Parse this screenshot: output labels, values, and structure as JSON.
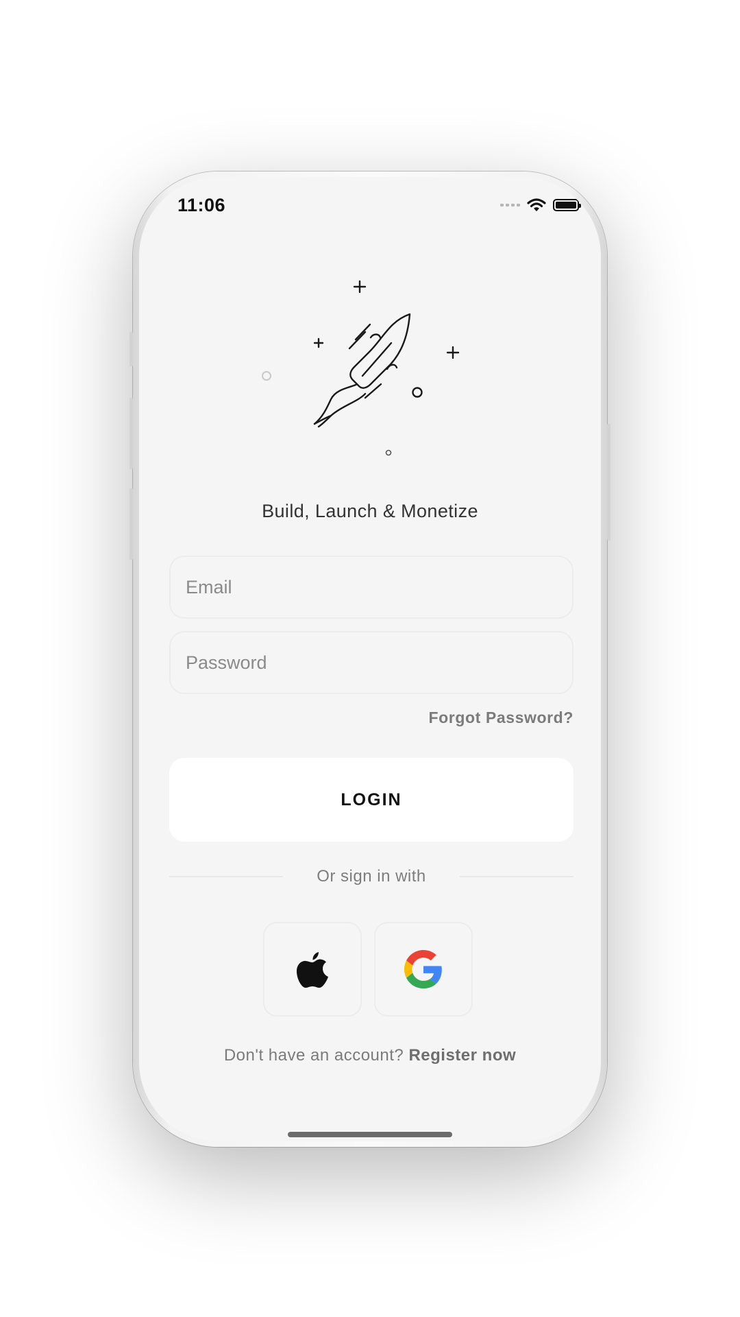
{
  "status_bar": {
    "time": "11:06",
    "signal_icon": "cellular-signal-icon",
    "wifi_icon": "wifi-icon",
    "battery_icon": "battery-icon"
  },
  "hero": {
    "illustration": "rocket-icon",
    "tagline": "Build, Launch & Monetize"
  },
  "form": {
    "email_placeholder": "Email",
    "email_value": "",
    "password_placeholder": "Password",
    "password_value": "",
    "forgot_label": "Forgot Password?",
    "login_label": "LOGIN"
  },
  "social": {
    "divider_text": "Or sign in with",
    "buttons": [
      {
        "icon": "apple-icon"
      },
      {
        "icon": "google-icon"
      }
    ]
  },
  "footer": {
    "prompt": "Don't have an account?",
    "register_label": "Register now"
  },
  "colors": {
    "screen_bg": "#f5f5f5",
    "button_bg": "#ffffff",
    "text_primary": "#111111",
    "text_muted": "#7b7b7b"
  }
}
